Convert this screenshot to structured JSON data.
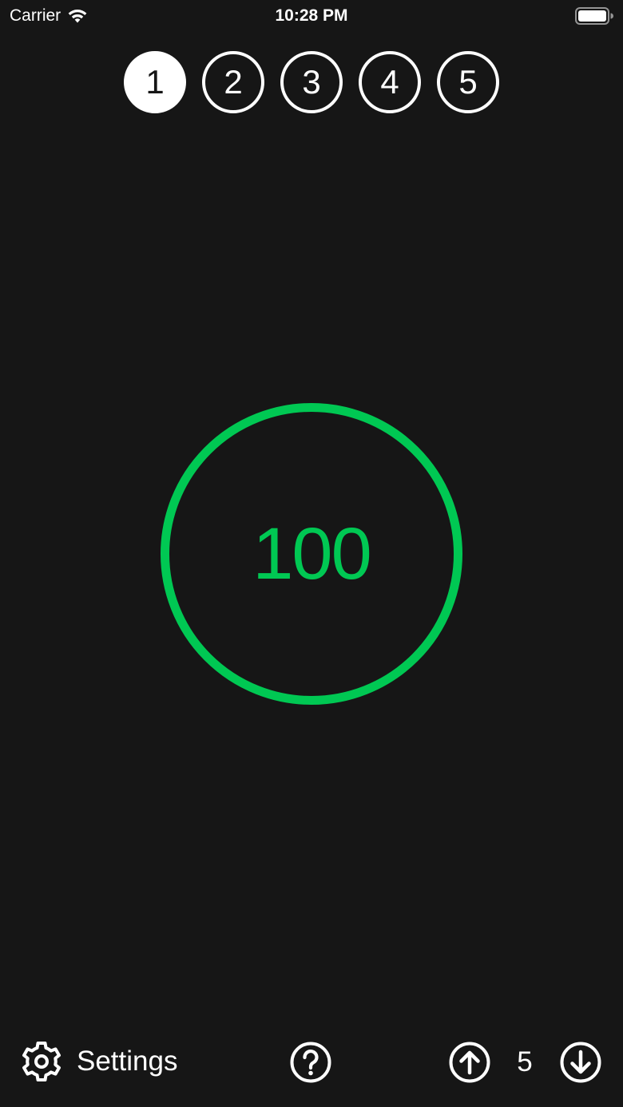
{
  "status_bar": {
    "carrier": "Carrier",
    "time": "10:28 PM",
    "icons": [
      "wifi-icon",
      "battery-icon"
    ]
  },
  "players": {
    "items": [
      {
        "label": "1",
        "selected": true
      },
      {
        "label": "2",
        "selected": false
      },
      {
        "label": "3",
        "selected": false
      },
      {
        "label": "4",
        "selected": false
      },
      {
        "label": "5",
        "selected": false
      }
    ]
  },
  "score": {
    "value": "100",
    "color": "#00c853"
  },
  "toolbar": {
    "settings_label": "Settings",
    "step_value": "5",
    "icons": [
      "gear-icon",
      "help-icon",
      "arrow-up-circle-icon",
      "arrow-down-circle-icon"
    ]
  },
  "colors": {
    "background": "#161616",
    "foreground": "#ffffff",
    "accent": "#00c853"
  }
}
